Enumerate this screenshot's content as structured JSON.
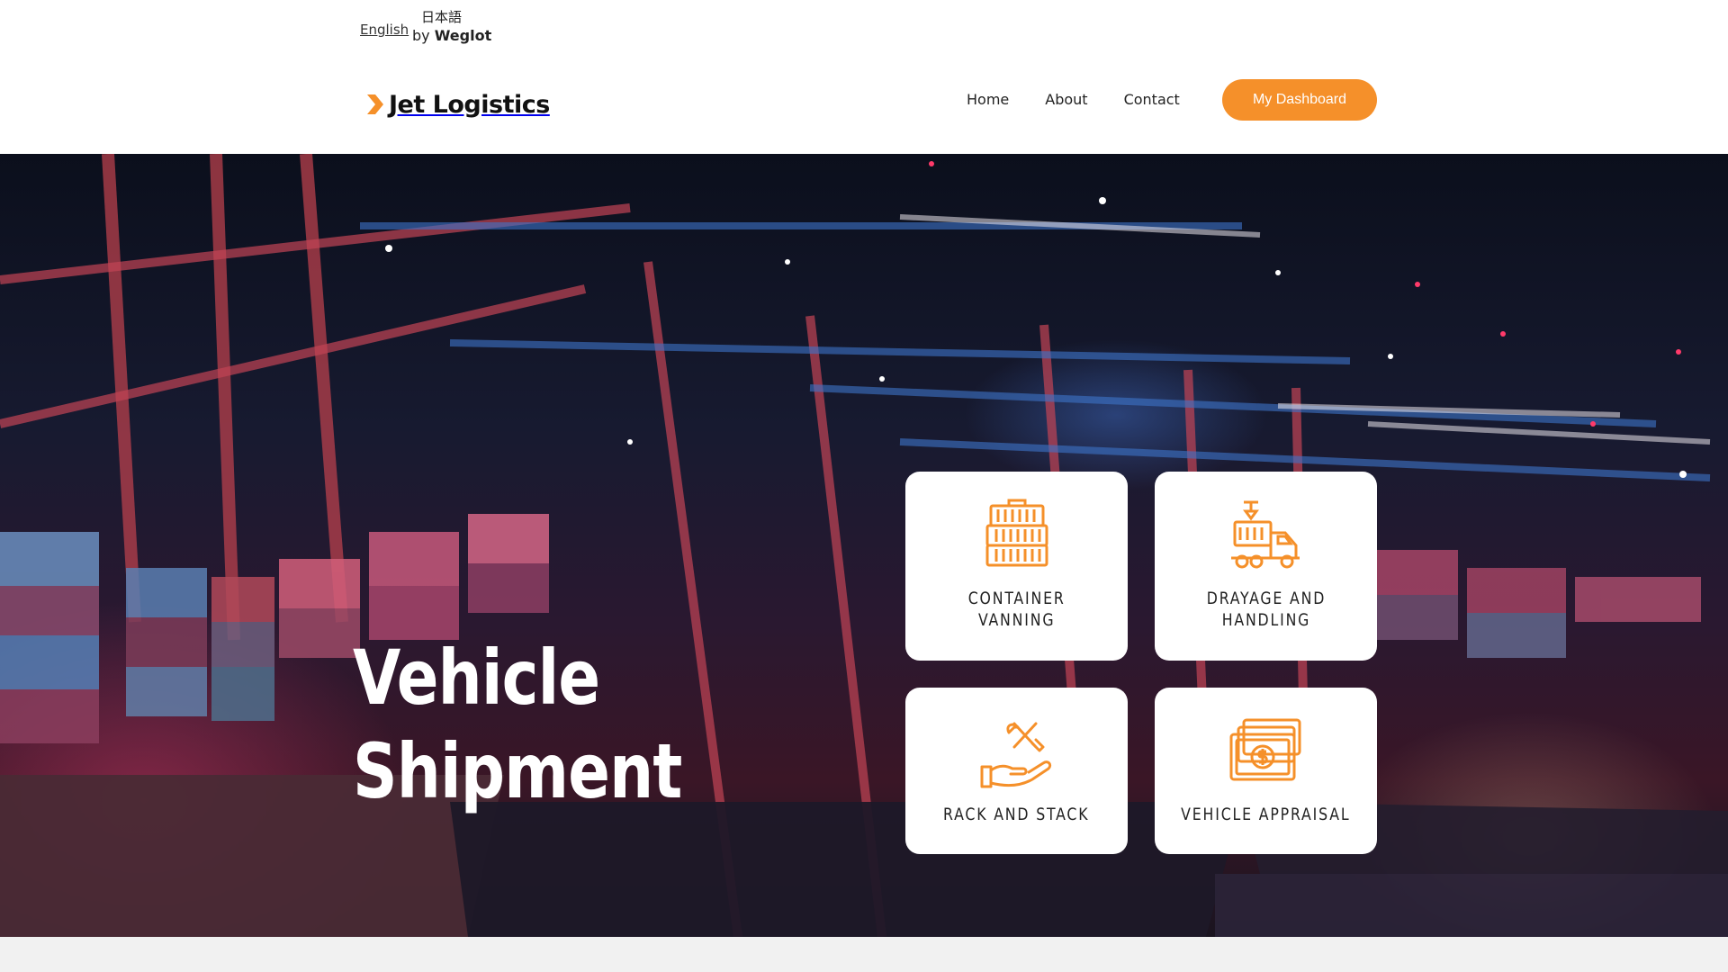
{
  "language_switcher": {
    "current": "English",
    "other": "日本語",
    "credit_prefix": "by",
    "credit_brand": "Weglot"
  },
  "header": {
    "logo_text": "Jet Logistics",
    "nav": [
      {
        "label": "Home"
      },
      {
        "label": "About"
      },
      {
        "label": "Contact"
      }
    ],
    "dashboard_button": "My Dashboard"
  },
  "hero": {
    "title_line1": "Vehicle",
    "title_line2": "Shipment"
  },
  "services": [
    {
      "line1": "CONTAINER",
      "line2": "VANNING",
      "icon": "container-icon"
    },
    {
      "line1": "DRAYAGE AND",
      "line2": "HANDLING",
      "icon": "truck-crane-icon"
    },
    {
      "line1": "RACK AND STACK",
      "line2": "",
      "icon": "hand-tools-icon"
    },
    {
      "line1": "VEHICLE APPRAISAL",
      "line2": "",
      "icon": "money-icon"
    }
  ],
  "colors": {
    "accent": "#f5902a",
    "text": "#222222",
    "card_bg": "#ffffff"
  }
}
